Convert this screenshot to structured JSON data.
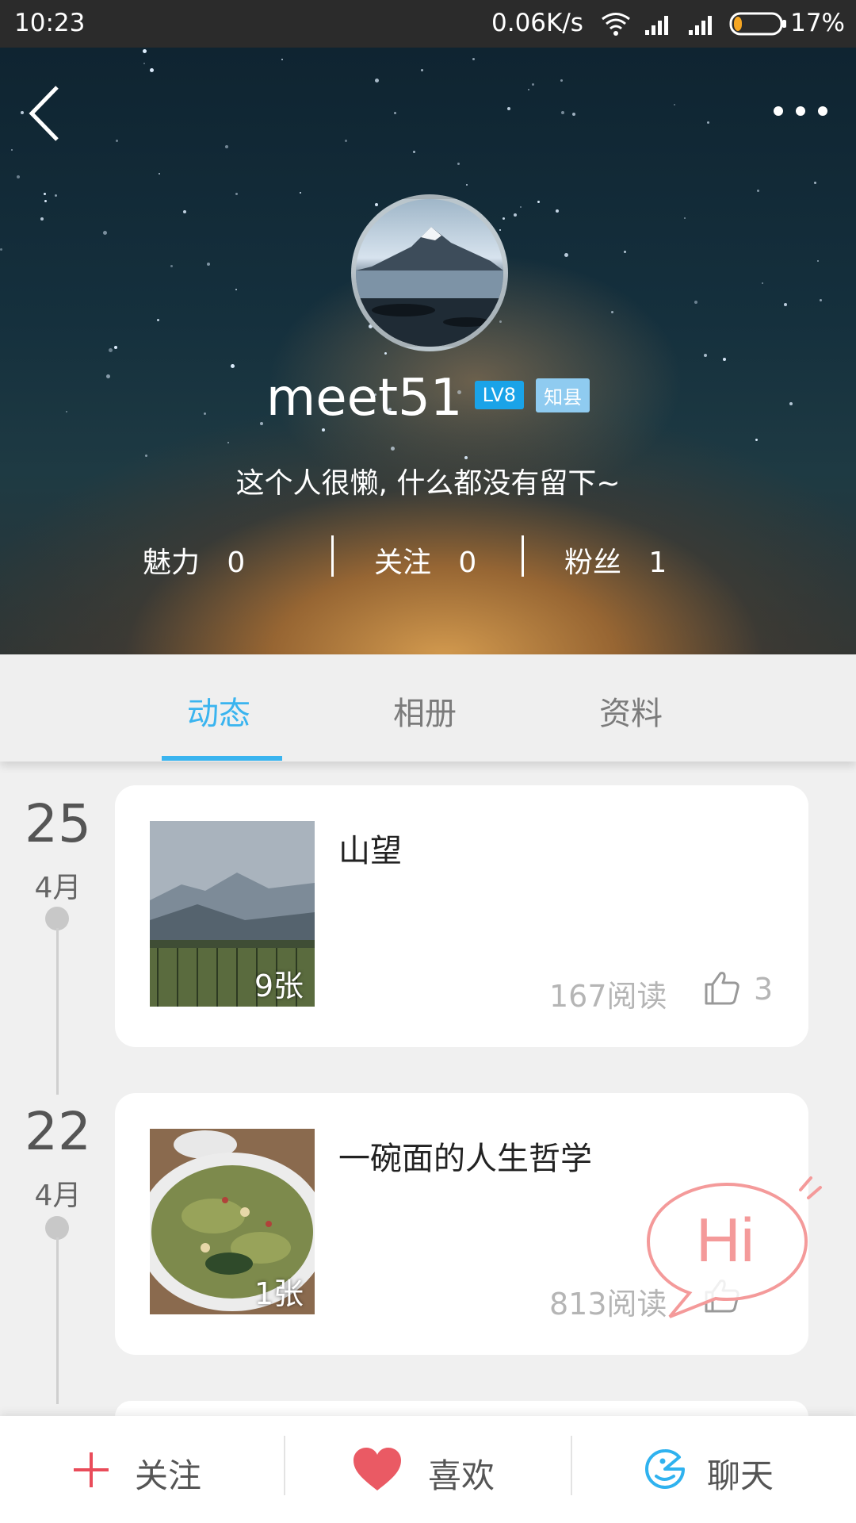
{
  "status_bar": {
    "time": "10:23",
    "network_speed": "0.06K/s",
    "battery_percent": "17%",
    "battery_level": 0.17,
    "icons": [
      "wifi-icon",
      "signal-icon",
      "signal-icon",
      "battery-icon"
    ]
  },
  "profile": {
    "username": "meet51",
    "level_badge": "LV8",
    "title_badge": "知县",
    "bio": "这个人很懒, 什么都没有留下~",
    "stats": [
      {
        "label": "魅力",
        "value": "0"
      },
      {
        "label": "关注",
        "value": "0"
      },
      {
        "label": "粉丝",
        "value": "1"
      }
    ]
  },
  "tabs": [
    {
      "label": "动态",
      "active": true
    },
    {
      "label": "相册",
      "active": false
    },
    {
      "label": "资料",
      "active": false
    }
  ],
  "posts": [
    {
      "day": "25",
      "month": "4月",
      "title": "山望",
      "photo_count": "9张",
      "reads": "167阅读",
      "likes": "3"
    },
    {
      "day": "22",
      "month": "4月",
      "title": "一碗面的人生哲学",
      "photo_count": "1张",
      "reads": "813阅读",
      "likes": ""
    }
  ],
  "floating": {
    "hi_label": "Hi"
  },
  "bottom_bar": {
    "follow_label": "关注",
    "like_label": "喜欢",
    "chat_label": "聊天"
  },
  "colors": {
    "accent": "#3ab4ef",
    "level_badge": "#1aa3e8",
    "title_badge": "#8fcbf0",
    "follow_plus": "#e94c5a",
    "heart": "#ea5a64",
    "hi_bubble": "#f49a9a"
  }
}
